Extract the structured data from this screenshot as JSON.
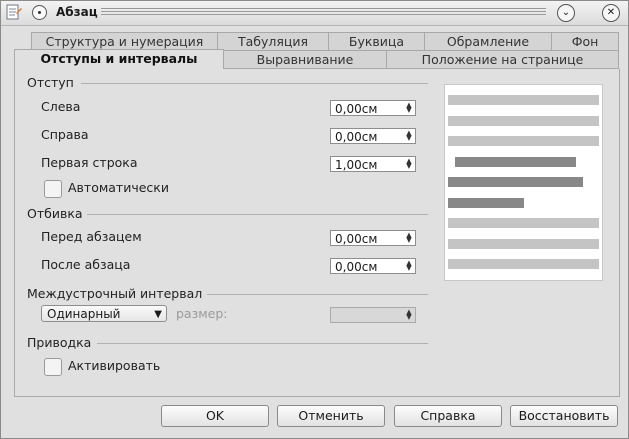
{
  "window": {
    "title": "Абзац"
  },
  "tabs_row1": [
    "Структура и нумерация",
    "Табуляция",
    "Буквица",
    "Обрамление",
    "Фон"
  ],
  "tabs_row2": [
    "Отступы и интервалы",
    "Выравнивание",
    "Положение на странице"
  ],
  "indent": {
    "header": "Отступ",
    "left_label": "Слева",
    "left_value": "0,00см",
    "right_label": "Справа",
    "right_value": "0,00см",
    "first_label": "Первая строка",
    "first_value": "1,00см",
    "auto_label": "Автоматически"
  },
  "spacing": {
    "header": "Отбивка",
    "before_label": "Перед абзацем",
    "before_value": "0,00см",
    "after_label": "После абзаца",
    "after_value": "0,00см"
  },
  "line_spacing": {
    "header": "Междустрочный интервал",
    "selected": "Одинарный",
    "size_label": "размер:",
    "size_value": ""
  },
  "register": {
    "header": "Приводка",
    "activate_label": "Активировать"
  },
  "buttons": {
    "ok": "OK",
    "cancel": "Отменить",
    "help": "Справка",
    "reset": "Восстановить"
  },
  "icons": {
    "app": "document-icon",
    "menu": "window-menu-icon",
    "minimize": "chevron-down-icon",
    "close": "close-icon"
  }
}
